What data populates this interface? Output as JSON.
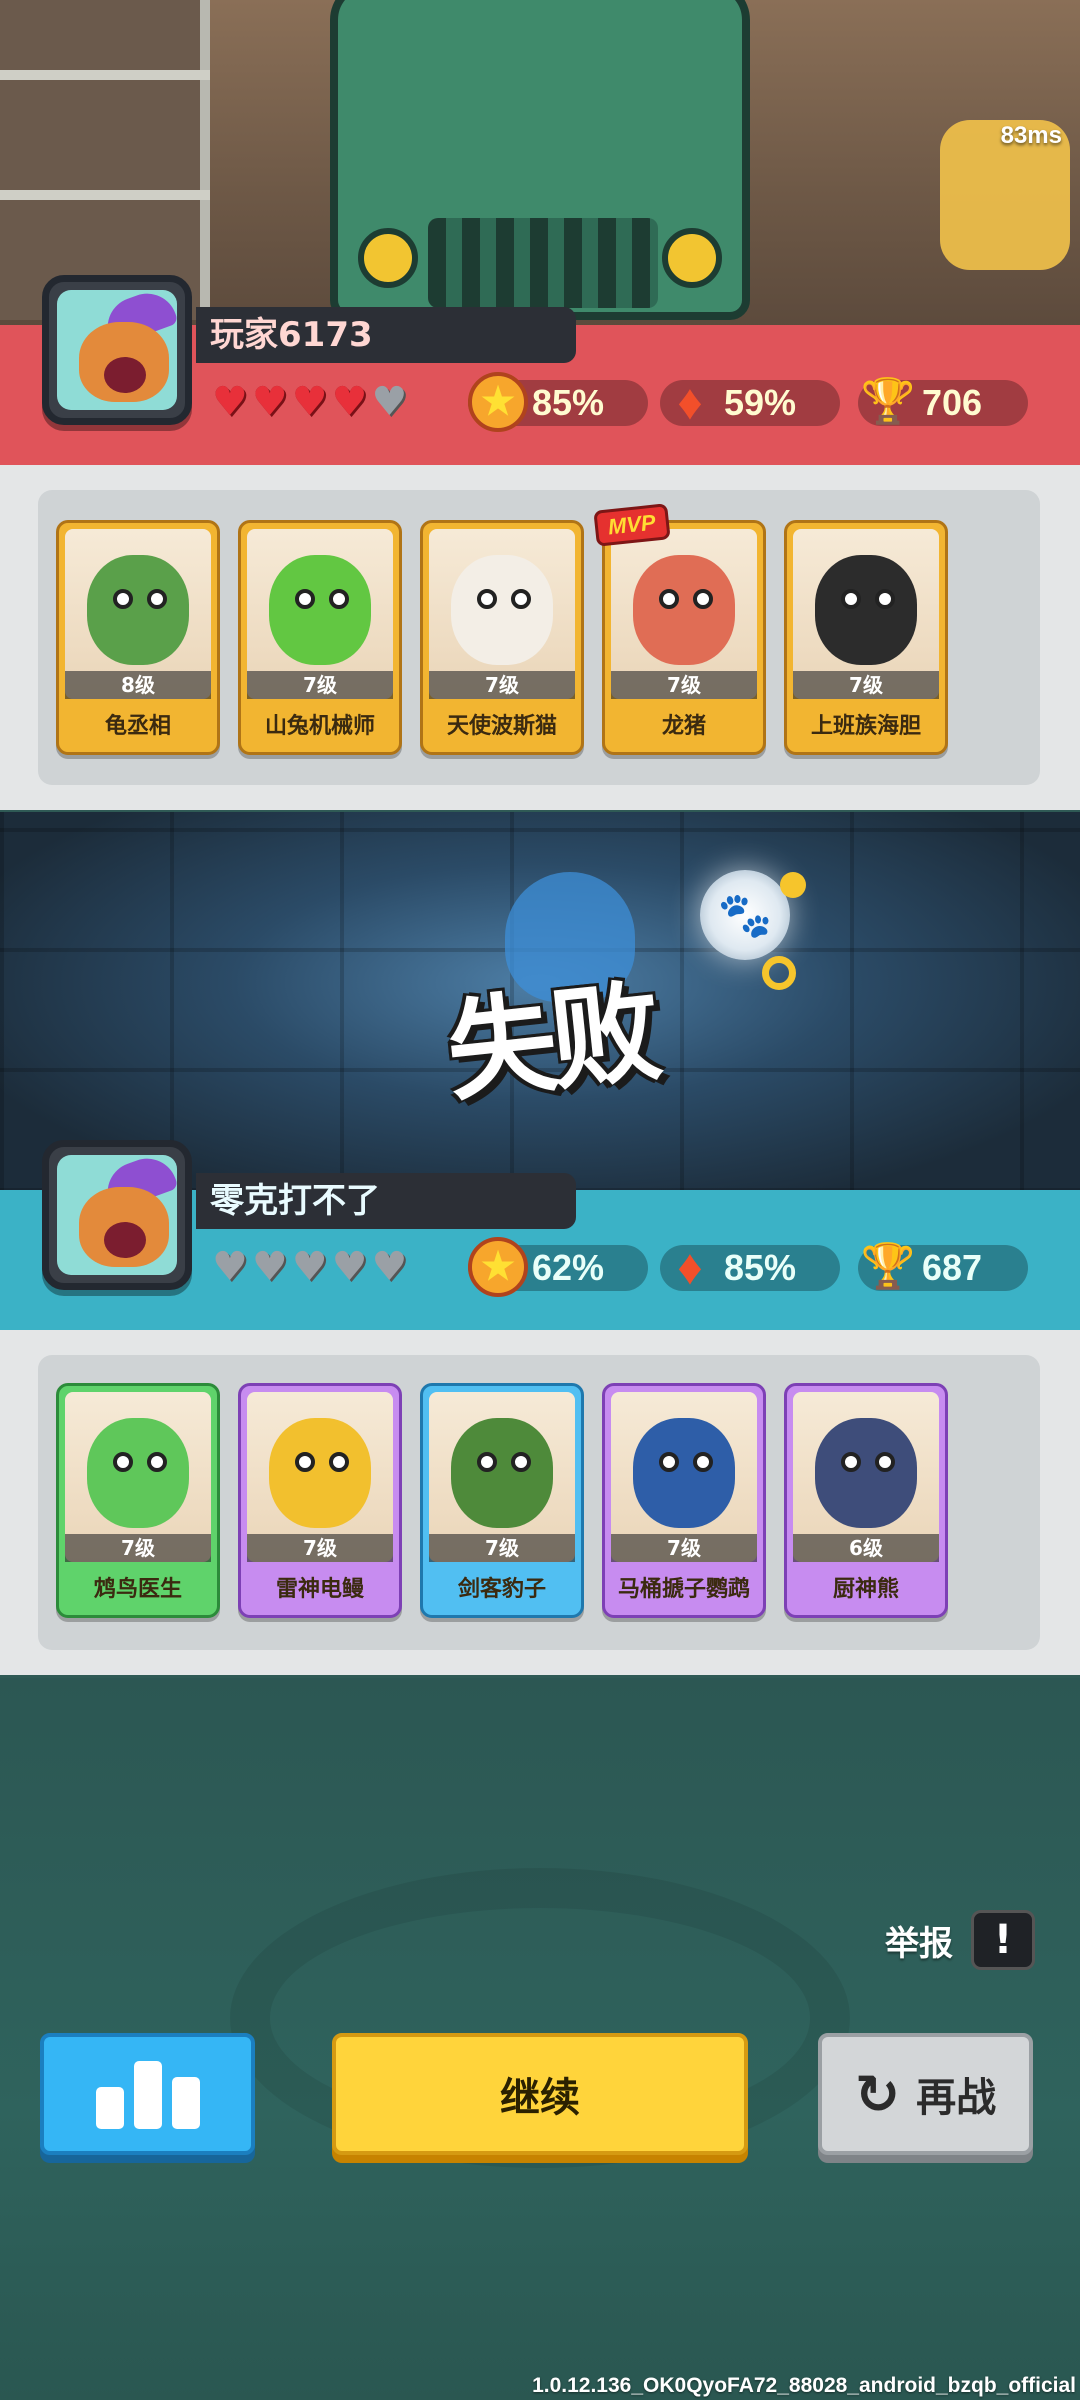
{
  "status": {
    "ping": "83ms"
  },
  "player1": {
    "name": "玩家6173",
    "hearts": [
      true,
      true,
      true,
      true,
      false
    ],
    "win_rate": "85%",
    "mvp_rate": "59%",
    "trophies": "706",
    "team_color": "#e0545a",
    "cards": [
      {
        "name": "龟丞相",
        "level": "8级",
        "rarity": "gold"
      },
      {
        "name": "山兔机械师",
        "level": "7级",
        "rarity": "gold"
      },
      {
        "name": "天使波斯猫",
        "level": "7级",
        "rarity": "gold"
      },
      {
        "name": "龙猪",
        "level": "7级",
        "rarity": "gold",
        "badge": "MVP"
      },
      {
        "name": "上班族海胆",
        "level": "7级",
        "rarity": "gold"
      }
    ]
  },
  "result": {
    "title": "失败"
  },
  "player2": {
    "name": "零克打不了",
    "hearts": [
      false,
      false,
      false,
      false,
      false
    ],
    "win_rate": "62%",
    "mvp_rate": "85%",
    "trophies": "687",
    "team_color": "#3bb2c6",
    "cards": [
      {
        "name": "鸩鸟医生",
        "level": "7级",
        "rarity": "green"
      },
      {
        "name": "雷神电鳗",
        "level": "7级",
        "rarity": "purple"
      },
      {
        "name": "剑客豹子",
        "level": "7级",
        "rarity": "blue"
      },
      {
        "name": "马桶搋子鹦鹉",
        "level": "7级",
        "rarity": "purple"
      },
      {
        "name": "厨神熊",
        "level": "6级",
        "rarity": "purple"
      }
    ]
  },
  "actions": {
    "report_label": "举报",
    "report_icon": "!",
    "stats_icon": "bar-chart-icon",
    "continue_label": "继续",
    "rematch_label": "再战"
  },
  "footer": {
    "version": "1.0.12.136_OK0QyoFA72_88028_android_bzqb_official"
  }
}
